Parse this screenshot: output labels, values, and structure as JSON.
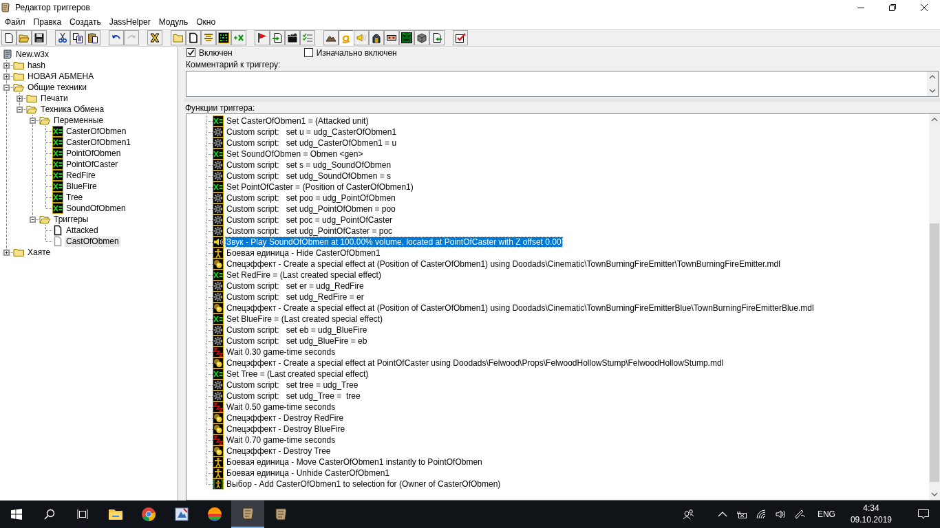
{
  "window": {
    "title": "Редактор триггеров"
  },
  "menu": [
    "Файл",
    "Правка",
    "Создать",
    "JassHelper",
    "Модуль",
    "Окно"
  ],
  "toolbar": [
    {
      "pressed": false,
      "disabled": false
    },
    {
      "pressed": false,
      "disabled": false
    },
    {
      "pressed": false,
      "disabled": false
    },
    {
      "pressed": false,
      "disabled": false
    },
    {
      "pressed": false,
      "disabled": false
    },
    {
      "pressed": false,
      "disabled": false
    },
    {
      "pressed": false,
      "disabled": false
    },
    {
      "pressed": false,
      "disabled": true
    },
    {
      "pressed": false,
      "disabled": false
    },
    {
      "pressed": false,
      "disabled": false
    },
    {
      "pressed": false,
      "disabled": false
    },
    {
      "pressed": false,
      "disabled": false
    },
    {
      "pressed": false,
      "disabled": false
    },
    {
      "pressed": false,
      "disabled": false
    },
    {
      "pressed": false,
      "disabled": false
    },
    {
      "pressed": false,
      "disabled": false
    },
    {
      "pressed": false,
      "disabled": false
    },
    {
      "pressed": false,
      "disabled": false
    },
    {
      "pressed": false,
      "disabled": false
    },
    {
      "pressed": true,
      "disabled": false
    },
    {
      "pressed": false,
      "disabled": false
    },
    {
      "pressed": false,
      "disabled": false
    },
    {
      "pressed": false,
      "disabled": false
    },
    {
      "pressed": false,
      "disabled": false
    },
    {
      "pressed": false,
      "disabled": false
    },
    {
      "pressed": false,
      "disabled": false
    },
    {
      "pressed": false,
      "disabled": false
    }
  ],
  "tree": {
    "label": "New.w3x",
    "kind": "map",
    "selected": false,
    "children": [
      {
        "label": "hash",
        "kind": "folder",
        "expanded": false,
        "selected": false
      },
      {
        "label": "НОВАЯ АБМЕНА",
        "kind": "folder",
        "expanded": false,
        "selected": false
      },
      {
        "label": "Общие техники",
        "kind": "folder",
        "expanded": true,
        "selected": false,
        "children": [
          {
            "label": "Печати",
            "kind": "folder",
            "expanded": false,
            "selected": false
          },
          {
            "label": "Техника Обмена",
            "kind": "folder",
            "expanded": true,
            "selected": false,
            "children": [
              {
                "label": "Переменные",
                "kind": "folder",
                "expanded": true,
                "selected": false,
                "children": [
                  {
                    "label": "CasterOfObmen",
                    "kind": "variable",
                    "selected": false
                  },
                  {
                    "label": "CasterOfObmen1",
                    "kind": "variable",
                    "selected": false
                  },
                  {
                    "label": "PointOfObmen",
                    "kind": "variable",
                    "selected": false
                  },
                  {
                    "label": "PointOfCaster",
                    "kind": "variable",
                    "selected": false
                  },
                  {
                    "label": "RedFire",
                    "kind": "variable",
                    "selected": false
                  },
                  {
                    "label": "BlueFire",
                    "kind": "variable",
                    "selected": false
                  },
                  {
                    "label": "Tree",
                    "kind": "variable",
                    "selected": false
                  },
                  {
                    "label": "SoundOfObmen",
                    "kind": "variable",
                    "selected": false
                  }
                ]
              },
              {
                "label": "Триггеры",
                "kind": "folder",
                "expanded": true,
                "selected": false,
                "children": [
                  {
                    "label": "Attacked",
                    "kind": "trigger",
                    "dimmed": false,
                    "selected": false
                  },
                  {
                    "label": "CastOfObmen",
                    "kind": "trigger",
                    "dimmed": true,
                    "selected": true
                  }
                ]
              }
            ]
          }
        ]
      },
      {
        "label": "Хаяте",
        "kind": "folder",
        "expanded": false,
        "selected": false
      }
    ]
  },
  "trigger": {
    "enabled": {
      "label": "Включен",
      "checked": true
    },
    "initially_enabled": {
      "label": "Изначально включен",
      "checked": false
    },
    "comment_label": "Комментарий к триггеру:",
    "functions_label": "Функции триггера:",
    "actions": [
      {
        "kind": "set",
        "text": "Set CasterOfObmen1 = (Attacked unit)",
        "selected": false
      },
      {
        "kind": "script",
        "text": "Custom script:   set u = udg_CasterOfObmen1",
        "selected": false
      },
      {
        "kind": "script",
        "text": "Custom script:   set udg_CasterOfObmen1 = u",
        "selected": false
      },
      {
        "kind": "set",
        "text": "Set SoundOfObmen = Obmen <gen>",
        "selected": false
      },
      {
        "kind": "script",
        "text": "Custom script:   set s = udg_SoundOfObmen",
        "selected": false
      },
      {
        "kind": "script",
        "text": "Custom script:   set udg_SoundOfObmen = s",
        "selected": false
      },
      {
        "kind": "set",
        "text": "Set PointOfCaster = (Position of CasterOfObmen1)",
        "selected": false
      },
      {
        "kind": "script",
        "text": "Custom script:   set poo = udg_PointOfObmen",
        "selected": false
      },
      {
        "kind": "script",
        "text": "Custom script:   set udg_PointOfObmen = poo",
        "selected": false
      },
      {
        "kind": "script",
        "text": "Custom script:   set poc = udg_PointOfCaster",
        "selected": false
      },
      {
        "kind": "script",
        "text": "Custom script:   set udg_PointOfCaster = poc",
        "selected": false
      },
      {
        "kind": "sound",
        "text": "Звук - Play SoundOfObmen at 100.00% volume, located at PointOfCaster with Z offset 0.00",
        "selected": true
      },
      {
        "kind": "unit",
        "text": "Боевая единица - Hide CasterOfObmen1",
        "selected": false
      },
      {
        "kind": "effect",
        "text": "Спецэффект - Create a special effect at (Position of CasterOfObmen1) using Doodads\\Cinematic\\TownBurningFireEmitter\\TownBurningFireEmitter.mdl",
        "selected": false
      },
      {
        "kind": "set",
        "text": "Set RedFire = (Last created special effect)",
        "selected": false
      },
      {
        "kind": "script",
        "text": "Custom script:   set er = udg_RedFire",
        "selected": false
      },
      {
        "kind": "script",
        "text": "Custom script:   set udg_RedFire = er",
        "selected": false
      },
      {
        "kind": "effect",
        "text": "Спецэффект - Create a special effect at (Position of CasterOfObmen1) using Doodads\\Cinematic\\TownBurningFireEmitterBlue\\TownBurningFireEmitterBlue.mdl",
        "selected": false
      },
      {
        "kind": "set",
        "text": "Set BlueFire = (Last created special effect)",
        "selected": false
      },
      {
        "kind": "script",
        "text": "Custom script:   set eb = udg_BlueFire",
        "selected": false
      },
      {
        "kind": "script",
        "text": "Custom script:   set udg_BlueFire = eb",
        "selected": false
      },
      {
        "kind": "wait",
        "text": "Wait 0.30 game-time seconds",
        "selected": false
      },
      {
        "kind": "effect",
        "text": "Спецэффект - Create a special effect at PointOfCaster using Doodads\\Felwood\\Props\\FelwoodHollowStump\\FelwoodHollowStump.mdl",
        "selected": false
      },
      {
        "kind": "set",
        "text": "Set Tree = (Last created special effect)",
        "selected": false
      },
      {
        "kind": "script",
        "text": "Custom script:   set tree = udg_Tree",
        "selected": false
      },
      {
        "kind": "script",
        "text": "Custom script:   set udg_Tree =  tree",
        "selected": false
      },
      {
        "kind": "wait",
        "text": "Wait 0.50 game-time seconds",
        "selected": false
      },
      {
        "kind": "effect",
        "text": "Спецэффект - Destroy RedFire",
        "selected": false
      },
      {
        "kind": "effect",
        "text": "Спецэффект - Destroy BlueFire",
        "selected": false
      },
      {
        "kind": "wait",
        "text": "Wait 0.70 game-time seconds",
        "selected": false
      },
      {
        "kind": "effect",
        "text": "Спецэффект - Destroy Tree",
        "selected": false
      },
      {
        "kind": "unit",
        "text": "Боевая единица - Move CasterOfObmen1 instantly to PointOfObmen",
        "selected": false
      },
      {
        "kind": "unit",
        "text": "Боевая единица - Unhide CasterOfObmen1",
        "selected": false
      },
      {
        "kind": "selection",
        "text": "Выбор - Add CasterOfObmen1 to selection for (Owner of CasterOfObmen)",
        "selected": false
      }
    ]
  },
  "taskbar": {
    "language": "ENG",
    "time": "4:34",
    "date": "09.10.2019"
  }
}
